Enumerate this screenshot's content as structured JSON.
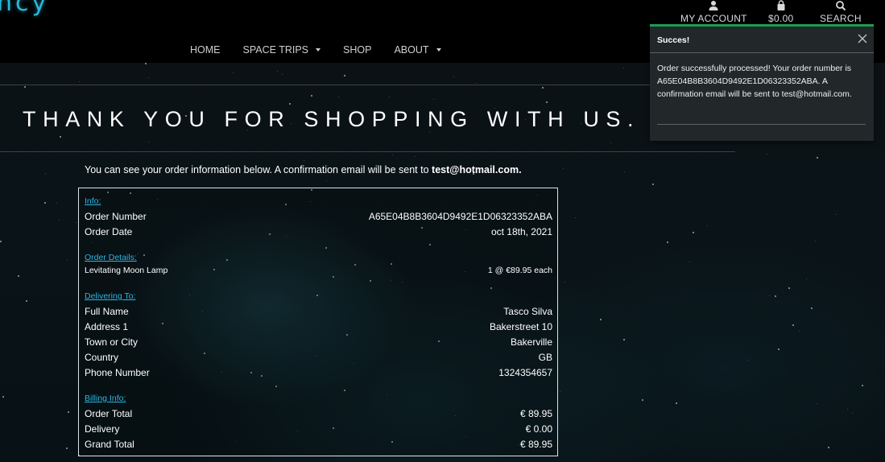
{
  "brand": {
    "partial_text": "ncy"
  },
  "utility": {
    "account_label": "MY ACCOUNT",
    "cart_label": "$0.00",
    "search_label": "SEARCH"
  },
  "nav": {
    "home": "HOME",
    "space_trips": "SPACE TRIPS",
    "shop": "SHOP",
    "about": "ABOUT"
  },
  "hero": {
    "title": "THANK YOU FOR SHOPPING WITH US."
  },
  "intro": {
    "text": "You can see your order information below. A confirmation email will be sent to ",
    "email": "test@hotmail.com."
  },
  "order": {
    "info_title": "Info:",
    "order_number_label": "Order Number",
    "order_number": "A65E04B8B3604D9492E1D06323352ABA",
    "order_date_label": "Order Date",
    "order_date": "oct 18th, 2021",
    "details_title": "Order Details:",
    "item_name": "Levitating Moon Lamp",
    "item_qty": "1 @ €89.95 each",
    "delivering_title": "Delivering To:",
    "full_name_label": "Full Name",
    "full_name": "Tasco Silva",
    "address1_label": "Address 1",
    "address1": "Bakerstreet 10",
    "town_label": "Town or City",
    "town": "Bakerville",
    "country_label": "Country",
    "country": "GB",
    "phone_label": "Phone Number",
    "phone": "1324354657",
    "billing_title": "Billing Info:",
    "order_total_label": "Order Total",
    "order_total": "€ 89.95",
    "delivery_label": "Delivery",
    "delivery": "€ 0.00",
    "grand_total_label": "Grand Total",
    "grand_total": "€ 89.95"
  },
  "toast": {
    "title": "Succes!",
    "message": "Order successfully processed! Your order number is A65E04B8B3604D9492E1D06323352ABA. A confirmation email will be sent to test@hotmail.com.",
    "accent_color": "#1f9c4e"
  },
  "colors": {
    "brand": "#2ab7d6",
    "link": "#2ab7e6",
    "background": "#000000"
  }
}
